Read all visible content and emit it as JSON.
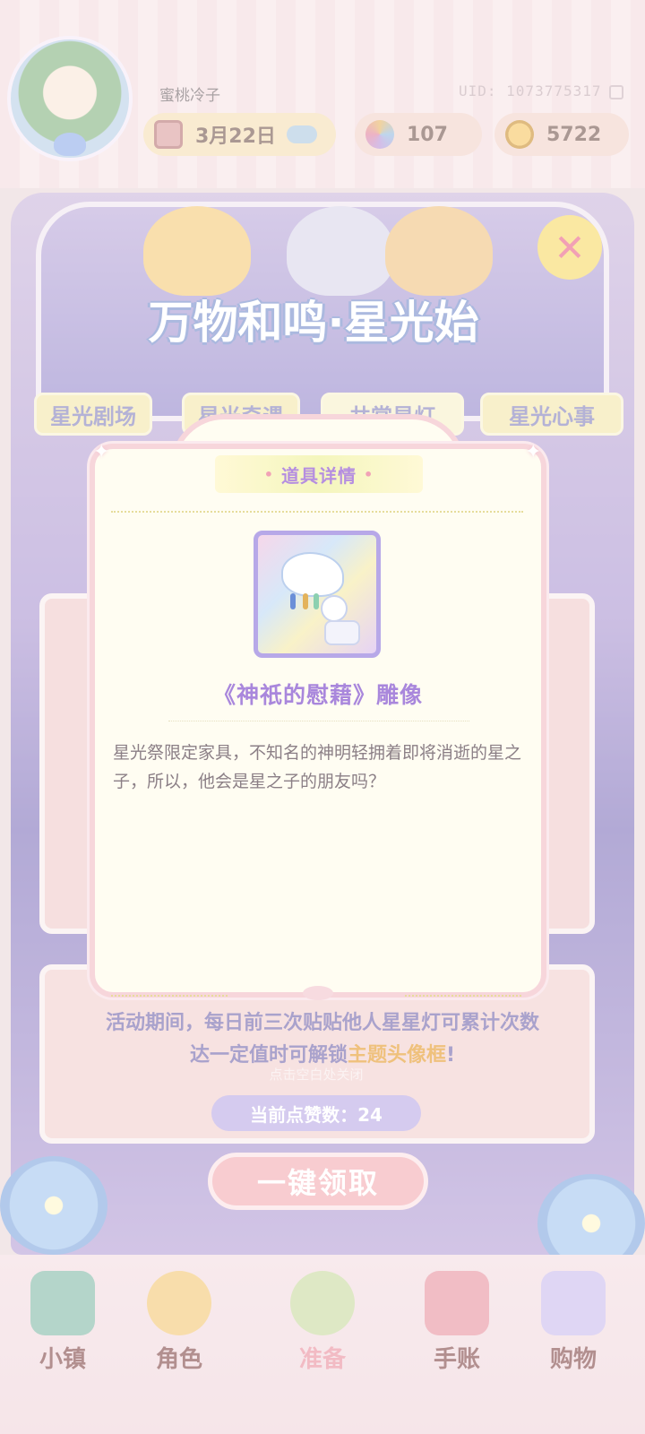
{
  "header": {
    "username": "蜜桃冷子",
    "uid": "UID: 1073775317",
    "date": "3月22日",
    "gems": "107",
    "coins": "5722"
  },
  "event": {
    "title": "万物和鸣·星光始",
    "tabs": [
      "星光剧场",
      "星光奇遇",
      "共赏星灯",
      "星光心事"
    ]
  },
  "activity": {
    "line1": "活动期间，每日前三次贴贴他人星星灯可累计次数",
    "line2_prefix": "达一定值时可解锁",
    "line2_highlight": "主题头像框",
    "line2_suffix": "!",
    "hint": "点击空白处关闭",
    "likes": "当前点赞数：24",
    "claim_button": "一键领取"
  },
  "modal": {
    "title": "道具详情",
    "item_name": "《神祇的慰藉》雕像",
    "item_description": "星光祭限定家具，不知名的神明轻拥着即将消逝的星之子，所以，他会是星之子的朋友吗？"
  },
  "bottom_nav": [
    "小镇",
    "角色",
    "准备",
    "手账",
    "购物"
  ],
  "colors": {
    "modal_bg": "#fffdf2",
    "modal_border": "#f7d6db",
    "item_name": "#a987dc",
    "title_text": "#b58ee0",
    "highlight": "#e3941e"
  },
  "icons": {
    "calendar": "calendar-icon",
    "gem": "flower-gem-icon",
    "coin": "coin-icon",
    "close": "close-icon"
  }
}
